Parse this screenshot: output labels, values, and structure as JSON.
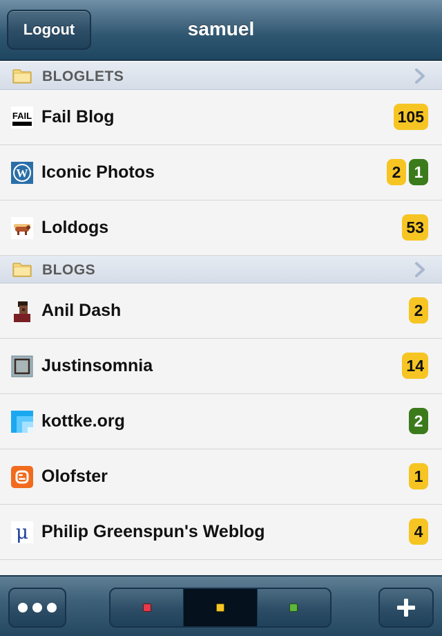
{
  "navbar": {
    "logout_label": "Logout",
    "title": "samuel"
  },
  "sections": [
    {
      "label": "BLOGLETS",
      "feeds": [
        {
          "title": "Fail Blog",
          "icon": "fail-blog-icon",
          "badges": [
            {
              "value": "105",
              "color": "yellow"
            }
          ]
        },
        {
          "title": "Iconic Photos",
          "icon": "wordpress-icon",
          "badges": [
            {
              "value": "2",
              "color": "yellow"
            },
            {
              "value": "1",
              "color": "green"
            }
          ]
        },
        {
          "title": "Loldogs",
          "icon": "hotdog-icon",
          "badges": [
            {
              "value": "53",
              "color": "yellow"
            }
          ]
        }
      ]
    },
    {
      "label": "BLOGS",
      "feeds": [
        {
          "title": "Anil Dash",
          "icon": "avatar-icon",
          "badges": [
            {
              "value": "2",
              "color": "yellow"
            }
          ]
        },
        {
          "title": "Justinsomnia",
          "icon": "square-frame-icon",
          "badges": [
            {
              "value": "14",
              "color": "yellow"
            }
          ]
        },
        {
          "title": "kottke.org",
          "icon": "kottke-icon",
          "badges": [
            {
              "value": "2",
              "color": "green"
            }
          ]
        },
        {
          "title": "Olofster",
          "icon": "blogger-icon",
          "badges": [
            {
              "value": "1",
              "color": "yellow"
            }
          ]
        },
        {
          "title": "Philip Greenspun's Weblog",
          "icon": "mu-icon",
          "badges": [
            {
              "value": "4",
              "color": "yellow"
            }
          ]
        }
      ]
    }
  ],
  "toolbar": {
    "more_icon": "ellipsis-icon",
    "add_icon": "plus-icon",
    "segments": [
      {
        "name": "filter-red",
        "color": "#e8394a"
      },
      {
        "name": "filter-yellow",
        "color": "#f6c523"
      },
      {
        "name": "filter-green",
        "color": "#5cb83a"
      }
    ],
    "selected_segment": 1
  },
  "colors": {
    "badge_yellow": "#f6c523",
    "badge_green": "#3c7b1c",
    "navbar": "#2f5670"
  }
}
